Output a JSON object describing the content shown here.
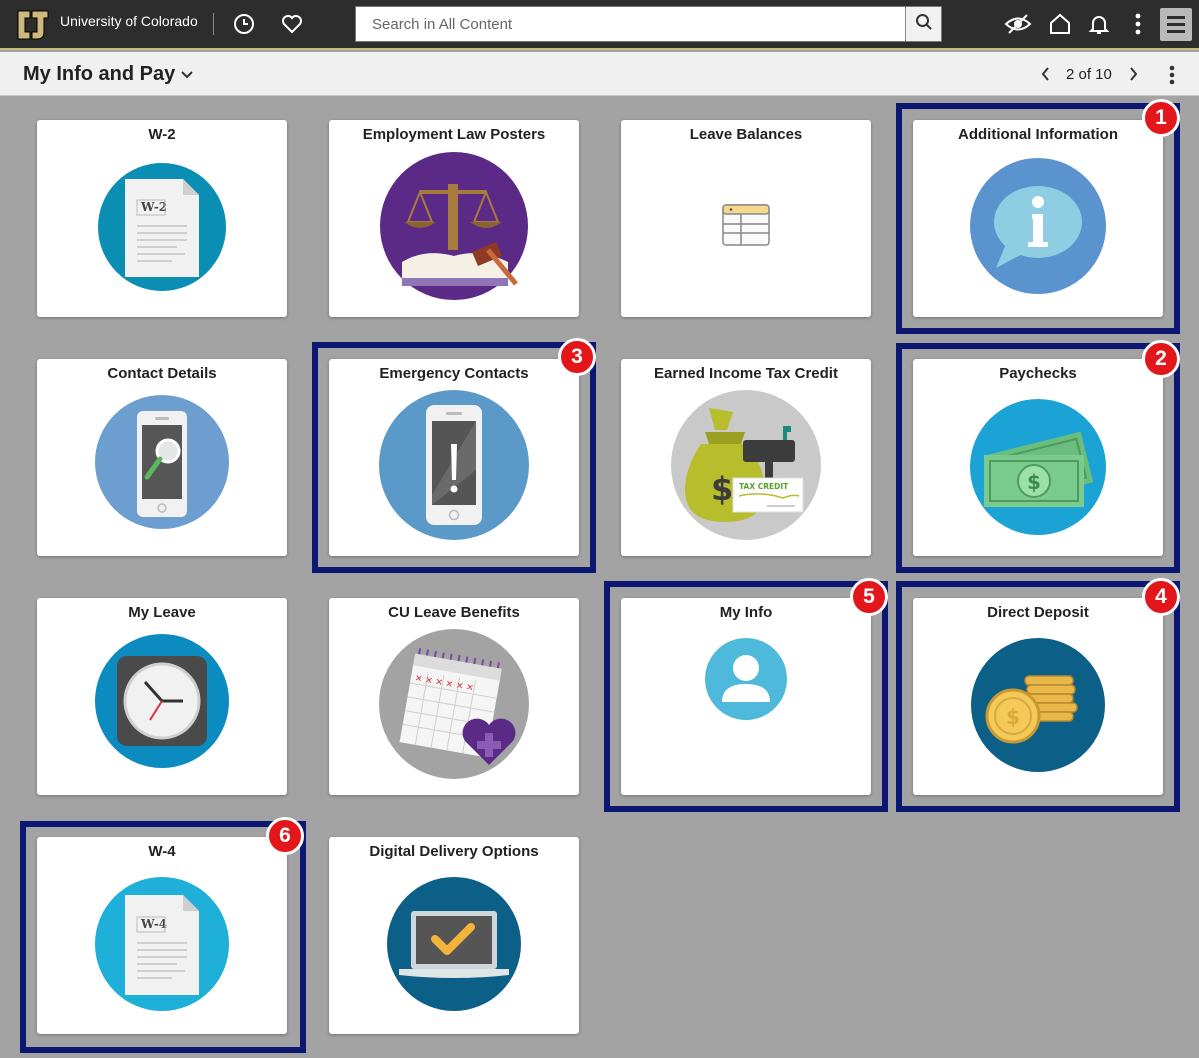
{
  "topbar": {
    "university": "University of Colorado",
    "search_placeholder": "Search in All Content",
    "icons": [
      "recent-icon",
      "favorites-icon",
      "search-icon",
      "accessibility-icon",
      "home-icon",
      "notifications-icon",
      "more-icon",
      "navbar-menu-icon"
    ]
  },
  "header": {
    "title": "My Info and Pay",
    "pager": "2 of 10"
  },
  "tiles": [
    {
      "title": "W-2",
      "icon": "w2-document-icon",
      "doc_label": "W-2",
      "circle_color": "#0b8eb3"
    },
    {
      "title": "Employment Law Posters",
      "icon": "scales-of-justice-icon",
      "circle_color": "#5b2a86"
    },
    {
      "title": "Leave Balances",
      "icon": "table-icon"
    },
    {
      "title": "Additional Information",
      "icon": "info-bubble-icon",
      "circle_color": "#5b93cf"
    },
    {
      "title": "Contact Details",
      "icon": "phone-search-icon",
      "circle_color": "#6c9ecf"
    },
    {
      "title": "Emergency Contacts",
      "icon": "phone-alert-icon",
      "circle_color": "#5b9ac8"
    },
    {
      "title": "Earned Income Tax Credit",
      "icon": "tax-credit-icon",
      "tax_label": "TAX CREDIT",
      "circle_color": "#c9c9c9"
    },
    {
      "title": "Paychecks",
      "icon": "cash-icon",
      "circle_color": "#1aa3d4"
    },
    {
      "title": "My Leave",
      "icon": "clock-icon",
      "circle_color": "#0b8bbf"
    },
    {
      "title": "CU Leave Benefits",
      "icon": "calendar-heart-icon",
      "circle_color": "#a3a3a3"
    },
    {
      "title": "My Info",
      "icon": "user-icon",
      "circle_color": "#4fb9dc"
    },
    {
      "title": "Direct Deposit",
      "icon": "coins-icon",
      "circle_color": "#0c5f86"
    },
    {
      "title": "W-4",
      "icon": "w4-document-icon",
      "doc_label": "W-4",
      "circle_color": "#1fb0d9"
    },
    {
      "title": "Digital Delivery Options",
      "icon": "laptop-check-icon",
      "circle_color": "#0c5f86"
    }
  ],
  "callouts": [
    "1",
    "2",
    "3",
    "4",
    "5",
    "6"
  ],
  "colors": {
    "highlight": "#0c1772",
    "badge": "#e3161b",
    "topbar": "#2d2d2d",
    "accent_gold": "#cfb87c"
  }
}
